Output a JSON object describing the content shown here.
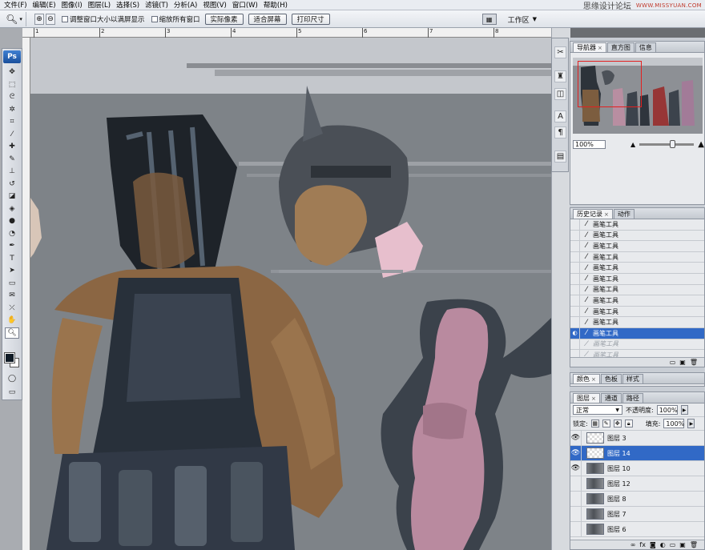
{
  "menu": [
    "文件(F)",
    "编辑(E)",
    "图像(I)",
    "图层(L)",
    "选择(S)",
    "滤镜(T)",
    "分析(A)",
    "视图(V)",
    "窗口(W)",
    "帮助(H)"
  ],
  "watermark": {
    "cn": "思缘设计论坛",
    "url": "WWW.MISSYUAN.COM"
  },
  "options": {
    "tool_preset_icon": "zoom-icon",
    "zoom_in": "⊕",
    "zoom_out": "⊖",
    "chk_resize": "调整窗口大小以满屏显示",
    "chk_all": "缩放所有窗口",
    "btn_actual": "实际像素",
    "btn_fit": "适合屏幕",
    "btn_print": "打印尺寸"
  },
  "workspace": {
    "label": "工作区",
    "arrow": "▼"
  },
  "ruler_labels": [
    "1",
    "2",
    "3",
    "4",
    "5",
    "6",
    "7",
    "8"
  ],
  "toolbox": {
    "logo": "Ps"
  },
  "navigator": {
    "tabs": [
      "导航器",
      "直方图",
      "信息"
    ],
    "zoom": "100%"
  },
  "history": {
    "tabs": [
      "历史记录",
      "动作"
    ],
    "items": [
      {
        "label": "画笔工具",
        "state": "normal"
      },
      {
        "label": "画笔工具",
        "state": "normal"
      },
      {
        "label": "画笔工具",
        "state": "normal"
      },
      {
        "label": "画笔工具",
        "state": "normal"
      },
      {
        "label": "画笔工具",
        "state": "normal"
      },
      {
        "label": "画笔工具",
        "state": "normal"
      },
      {
        "label": "画笔工具",
        "state": "normal"
      },
      {
        "label": "画笔工具",
        "state": "normal"
      },
      {
        "label": "画笔工具",
        "state": "normal"
      },
      {
        "label": "画笔工具",
        "state": "normal"
      },
      {
        "label": "画笔工具",
        "state": "selected"
      },
      {
        "label": "画笔工具",
        "state": "disabled"
      },
      {
        "label": "画笔工具",
        "state": "disabled"
      }
    ]
  },
  "color_panel": {
    "tabs": [
      "颜色",
      "色板",
      "样式"
    ]
  },
  "layers": {
    "tabs": [
      "图层",
      "通道",
      "路径"
    ],
    "blend_mode": "正常",
    "opacity_label": "不透明度:",
    "opacity": "100%",
    "lock_label": "锁定:",
    "fill_label": "填充:",
    "fill": "100%",
    "items": [
      {
        "name": "图层 3",
        "visible": true,
        "selected": false,
        "thumb": "empty"
      },
      {
        "name": "图层 14",
        "visible": true,
        "selected": true,
        "thumb": "empty"
      },
      {
        "name": "图层 10",
        "visible": true,
        "selected": false,
        "thumb": "art"
      },
      {
        "name": "图层 12",
        "visible": false,
        "selected": false,
        "thumb": "art"
      },
      {
        "name": "图层 8",
        "visible": false,
        "selected": false,
        "thumb": "art"
      },
      {
        "name": "图层 7",
        "visible": false,
        "selected": false,
        "thumb": "art"
      },
      {
        "name": "图层 6",
        "visible": false,
        "selected": false,
        "thumb": "art"
      }
    ]
  },
  "colors": {
    "selection": "#3169c6",
    "nav_frame": "#e32020",
    "foreground": "#0f1a25"
  }
}
